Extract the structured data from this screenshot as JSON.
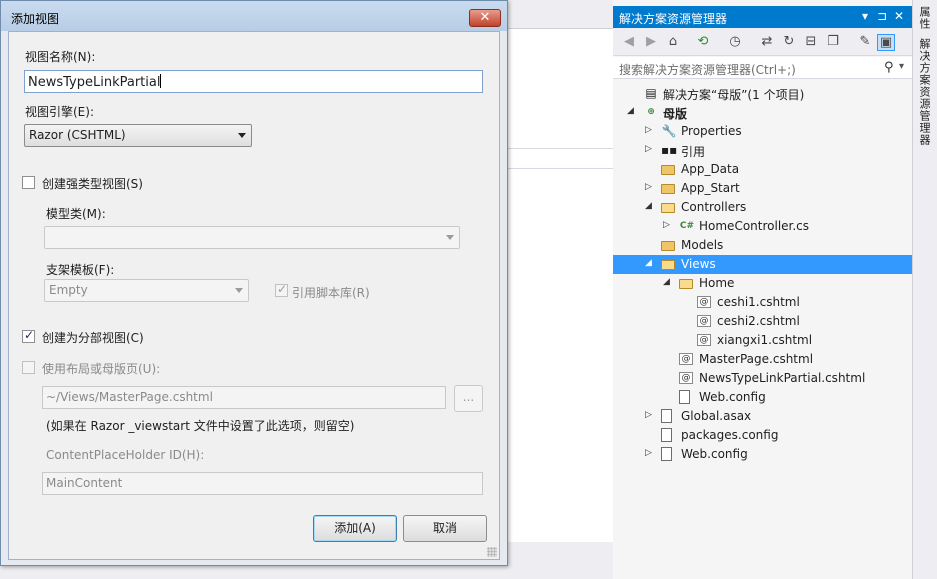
{
  "dialog": {
    "title": "添加视图",
    "close_glyph": "✕",
    "view_name_label": "视图名称(N):",
    "view_name_value": "NewsTypeLinkPartial",
    "view_engine_label": "视图引擎(E):",
    "view_engine_value": "Razor (CSHTML)",
    "strongly_typed_label": "创建强类型视图(S)",
    "strongly_typed_checked": false,
    "model_class_label": "模型类(M):",
    "model_class_value": "",
    "scaffold_label": "支架模板(F):",
    "scaffold_value": "Empty",
    "ref_scripts_label": "引用脚本库(R)",
    "ref_scripts_checked": true,
    "partial_view_label": "创建为分部视图(C)",
    "partial_view_checked": true,
    "use_layout_label": "使用布局或母版页(U):",
    "use_layout_checked": false,
    "layout_path_value": "~/Views/MasterPage.cshtml",
    "browse_label": "...",
    "layout_hint": "(如果在 Razor _viewstart 文件中设置了此选项，则留空)",
    "placeholder_id_label": "ContentPlaceHolder ID(H):",
    "placeholder_id_value": "MainContent",
    "add_button": "添加(A)",
    "cancel_button": "取消"
  },
  "solution_explorer": {
    "title": "解决方案资源管理器",
    "title_icons": [
      "▾",
      "⊐",
      "✕"
    ],
    "search_placeholder": "搜索解决方案资源管理器(Ctrl+;)",
    "search_icon": "search-icon",
    "toolbar_icons": [
      "back-icon",
      "forward-icon",
      "home-icon",
      "sync-icon",
      "history-icon",
      "switch-icon",
      "refresh-icon",
      "collapse-icon",
      "copy-icon",
      "properties-icon",
      "preview-icon"
    ],
    "tree": [
      {
        "label": "解决方案“母版”(1 个项目)",
        "level": 0,
        "expander": "",
        "icon": "solution-icon",
        "bold": false
      },
      {
        "label": "母版",
        "level": 0,
        "expander": "open",
        "icon": "web-project-icon",
        "bold": true
      },
      {
        "label": "Properties",
        "level": 1,
        "expander": "closed",
        "icon": "wrench-icon",
        "bold": false
      },
      {
        "label": "引用",
        "level": 1,
        "expander": "closed",
        "icon": "references-icon",
        "bold": false
      },
      {
        "label": "App_Data",
        "level": 1,
        "expander": "",
        "icon": "folder-icon",
        "bold": false
      },
      {
        "label": "App_Start",
        "level": 1,
        "expander": "closed",
        "icon": "folder-icon",
        "bold": false
      },
      {
        "label": "Controllers",
        "level": 1,
        "expander": "open",
        "icon": "folder-open-icon",
        "bold": false
      },
      {
        "label": "HomeController.cs",
        "level": 2,
        "expander": "closed",
        "icon": "csharp-file-icon",
        "bold": false
      },
      {
        "label": "Models",
        "level": 1,
        "expander": "",
        "icon": "folder-icon",
        "bold": false
      },
      {
        "label": "Views",
        "level": 1,
        "expander": "open",
        "icon": "folder-open-icon",
        "bold": false,
        "selected": true
      },
      {
        "label": "Home",
        "level": 2,
        "expander": "open",
        "icon": "folder-open-icon",
        "bold": false
      },
      {
        "label": "ceshi1.cshtml",
        "level": 3,
        "expander": "",
        "icon": "razor-file-icon",
        "bold": false
      },
      {
        "label": "ceshi2.cshtml",
        "level": 3,
        "expander": "",
        "icon": "razor-file-icon",
        "bold": false
      },
      {
        "label": "xiangxi1.cshtml",
        "level": 3,
        "expander": "",
        "icon": "razor-file-icon",
        "bold": false
      },
      {
        "label": "MasterPage.cshtml",
        "level": 2,
        "expander": "",
        "icon": "razor-file-icon",
        "bold": false
      },
      {
        "label": "NewsTypeLinkPartial.cshtml",
        "level": 2,
        "expander": "",
        "icon": "razor-file-icon",
        "bold": false
      },
      {
        "label": "Web.config",
        "level": 2,
        "expander": "",
        "icon": "config-file-icon",
        "bold": false
      },
      {
        "label": "Global.asax",
        "level": 1,
        "expander": "closed",
        "icon": "asax-file-icon",
        "bold": false
      },
      {
        "label": "packages.config",
        "level": 1,
        "expander": "",
        "icon": "config-file-icon",
        "bold": false
      },
      {
        "label": "Web.config",
        "level": 1,
        "expander": "closed",
        "icon": "config-file-icon",
        "bold": false
      }
    ]
  },
  "side_tabs": [
    "属性",
    "解决方案资源管理器"
  ]
}
